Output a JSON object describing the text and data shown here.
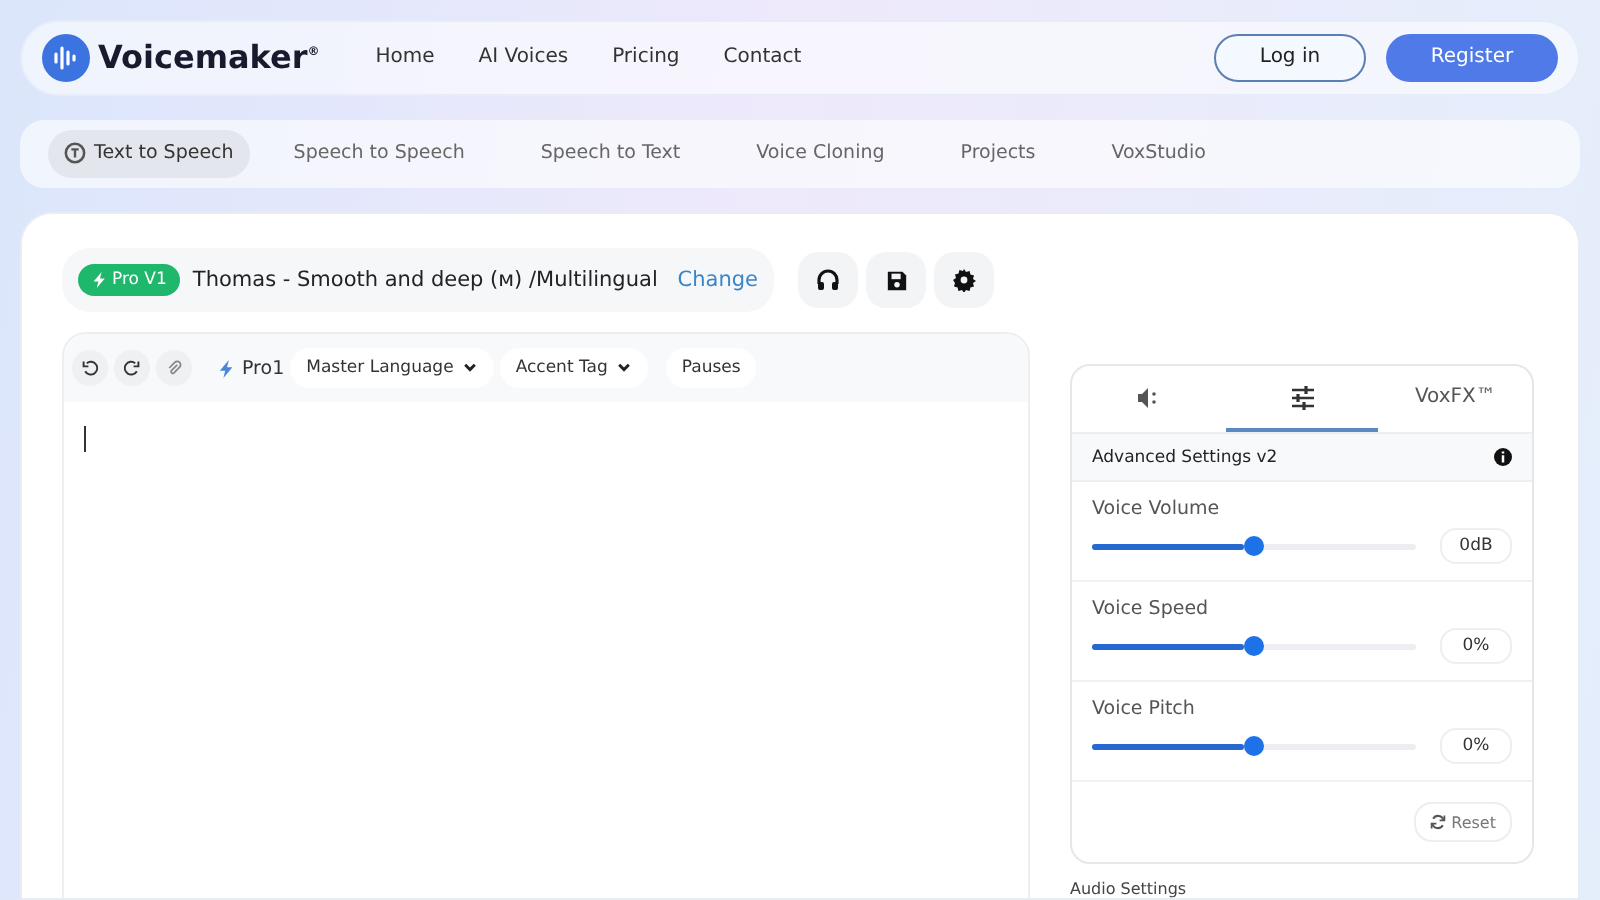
{
  "brand": {
    "name": "Voicemaker",
    "mark": "®"
  },
  "nav": [
    "Home",
    "AI Voices",
    "Pricing",
    "Contact"
  ],
  "auth": [
    {
      "label": "Log in",
      "kind": "outline"
    },
    {
      "label": "Register",
      "kind": "solid"
    }
  ],
  "subnav": [
    {
      "label": "Text to Speech",
      "selected": true
    },
    {
      "label": "Speech to Speech",
      "selected": false
    },
    {
      "label": "Speech to Text",
      "selected": false
    },
    {
      "label": "Voice Cloning",
      "selected": false
    },
    {
      "label": "Projects",
      "selected": false
    },
    {
      "label": "VoxStudio",
      "selected": false
    }
  ],
  "voice": {
    "badge": "Pro V1",
    "name": "Thomas - Smooth and deep (м) /Multilingual",
    "change": "Change"
  },
  "editor": {
    "engine": "Pro1",
    "menus": [
      {
        "label": "Master Language",
        "kind": "dropdown"
      },
      {
        "label": "Accent Tag",
        "kind": "dropdown"
      },
      {
        "label": "Pauses",
        "kind": "plain"
      }
    ]
  },
  "panel": {
    "tabs": [
      {
        "kind": "speaker",
        "selected": false
      },
      {
        "kind": "sliders",
        "selected": true
      },
      {
        "kind": "text",
        "label": "VoxFX™",
        "selected": false
      }
    ],
    "title": "Advanced Settings v2",
    "sliders": [
      {
        "name": "Voice Volume",
        "level": 0.5,
        "reading": "0dB"
      },
      {
        "name": "Voice Speed",
        "level": 0.5,
        "reading": "0%"
      },
      {
        "name": "Voice Pitch",
        "level": 0.5,
        "reading": "0%"
      }
    ],
    "reset": "Reset"
  },
  "audio_settings": "Audio Settings"
}
